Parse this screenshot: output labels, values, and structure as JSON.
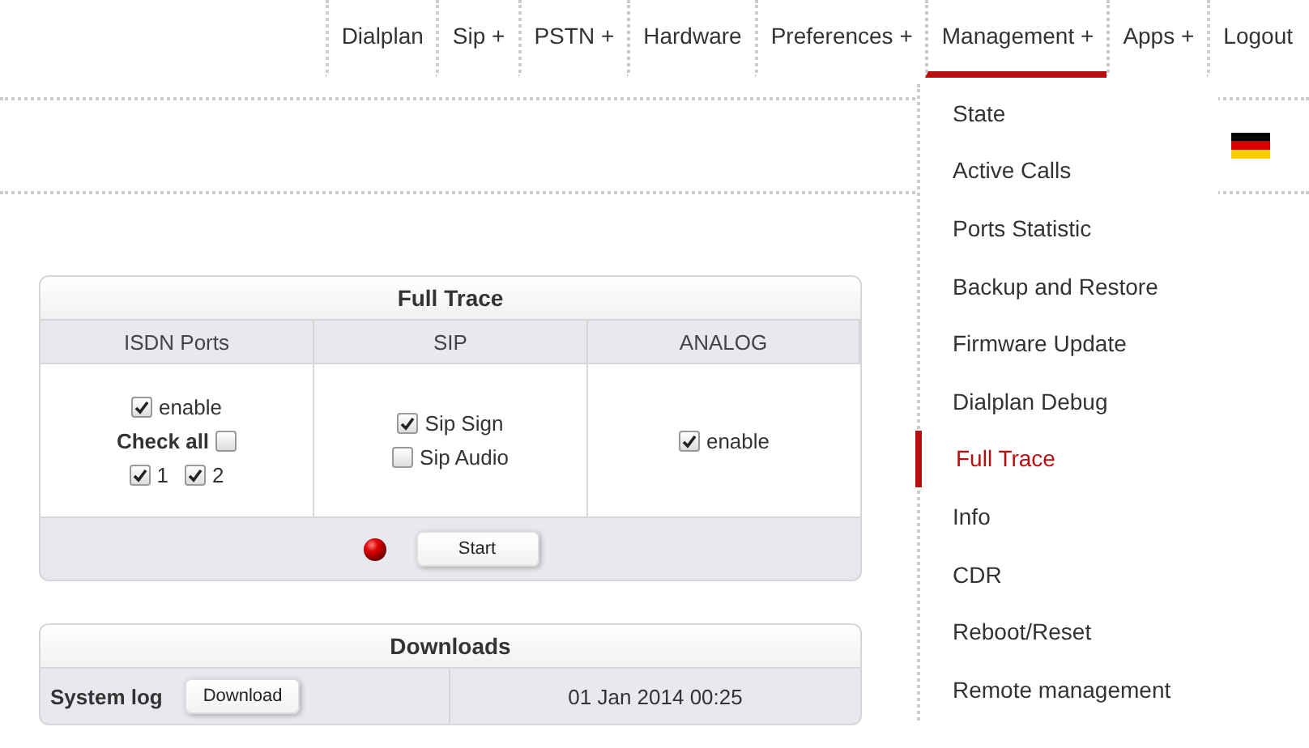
{
  "nav": [
    {
      "label": "Dialplan",
      "selected": false
    },
    {
      "label": "Sip +",
      "selected": false
    },
    {
      "label": "PSTN +",
      "selected": false
    },
    {
      "label": "Hardware",
      "selected": false
    },
    {
      "label": "Preferences +",
      "selected": false
    },
    {
      "label": "Management +",
      "selected": true
    },
    {
      "label": "Apps +",
      "selected": false
    },
    {
      "label": "Logout",
      "selected": false
    }
  ],
  "menu": [
    {
      "label": "State",
      "selected": false
    },
    {
      "label": "Active Calls",
      "selected": false
    },
    {
      "label": "Ports Statistic",
      "selected": false
    },
    {
      "label": "Backup and Restore",
      "selected": false
    },
    {
      "label": "Firmware Update",
      "selected": false
    },
    {
      "label": "Dialplan Debug",
      "selected": false
    },
    {
      "label": "Full Trace",
      "selected": true
    },
    {
      "label": "Info",
      "selected": false
    },
    {
      "label": "CDR",
      "selected": false
    },
    {
      "label": "Reboot/Reset",
      "selected": false
    },
    {
      "label": "Remote management",
      "selected": false
    }
  ],
  "full_trace": {
    "title": "Full Trace",
    "columns": [
      "ISDN Ports",
      "SIP",
      "ANALOG"
    ],
    "isdn": {
      "enable": {
        "label": "enable",
        "checked": true
      },
      "check_all": {
        "label": "Check all",
        "checked": false
      },
      "ports": [
        {
          "label": "1",
          "checked": true
        },
        {
          "label": "2",
          "checked": true
        }
      ]
    },
    "sip": [
      {
        "label": "Sip Sign",
        "checked": true
      },
      {
        "label": "Sip Audio",
        "checked": false
      }
    ],
    "analog": {
      "label": "enable",
      "checked": true
    },
    "start": "Start"
  },
  "downloads": {
    "title": "Downloads",
    "rows": [
      {
        "name": "System log",
        "button": "Download",
        "date": "01 Jan 2014 00:25"
      }
    ]
  }
}
